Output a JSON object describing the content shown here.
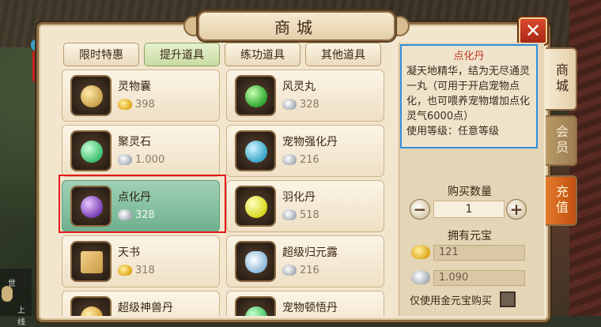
{
  "header": {
    "title": "商城",
    "close_label": "✕"
  },
  "tabs": [
    {
      "label": "限时特惠",
      "active": false
    },
    {
      "label": "提升道具",
      "active": true
    },
    {
      "label": "练功道具",
      "active": false
    },
    {
      "label": "其他道具",
      "active": false
    }
  ],
  "items": [
    {
      "name": "灵物囊",
      "price": "398",
      "currency": "gold",
      "orb": "#c9a24a"
    },
    {
      "name": "风灵丸",
      "price": "328",
      "currency": "silver",
      "orb": "#2fa82f"
    },
    {
      "name": "聚灵石",
      "price": "1.000",
      "currency": "silver",
      "orb": "#3fbf6f"
    },
    {
      "name": "宠物强化丹",
      "price": "216",
      "currency": "silver",
      "orb": "#3aa6c9"
    },
    {
      "name": "点化丹",
      "price": "328",
      "currency": "silver",
      "orb": "#7b3fb8",
      "selected": true
    },
    {
      "name": "羽化丹",
      "price": "518",
      "currency": "silver",
      "orb": "#d8d820"
    },
    {
      "name": "天书",
      "price": "318",
      "currency": "gold",
      "orb": "#c99a44"
    },
    {
      "name": "超级归元露",
      "price": "216",
      "currency": "silver",
      "orb": "#8ab8d8"
    },
    {
      "name": "超级神兽丹",
      "price": "",
      "currency": "gold",
      "orb": "#d8a030"
    },
    {
      "name": "宠物顿悟丹",
      "price": "",
      "currency": "silver",
      "orb": "#3fbf5f"
    }
  ],
  "detail": {
    "title": "点化丹",
    "body": "凝天地精华，结为无尽通灵一丸（可用于开启宠物点化，也可喂养宠物增加点化灵气6000点）",
    "usage": "使用等级：任意等级"
  },
  "purchase": {
    "qty_label": "购买数量",
    "qty_value": "1",
    "minus": "−",
    "plus": "+",
    "wallet_label": "拥有元宝",
    "gold_amount": "121",
    "silver_amount": "1.090",
    "only_gold_label": "仅使用金元宝购买"
  },
  "side_tabs": {
    "shop": "商城",
    "member": "会员",
    "recharge": "充值"
  },
  "chat": {
    "line1": "世",
    "line2": "上线"
  }
}
